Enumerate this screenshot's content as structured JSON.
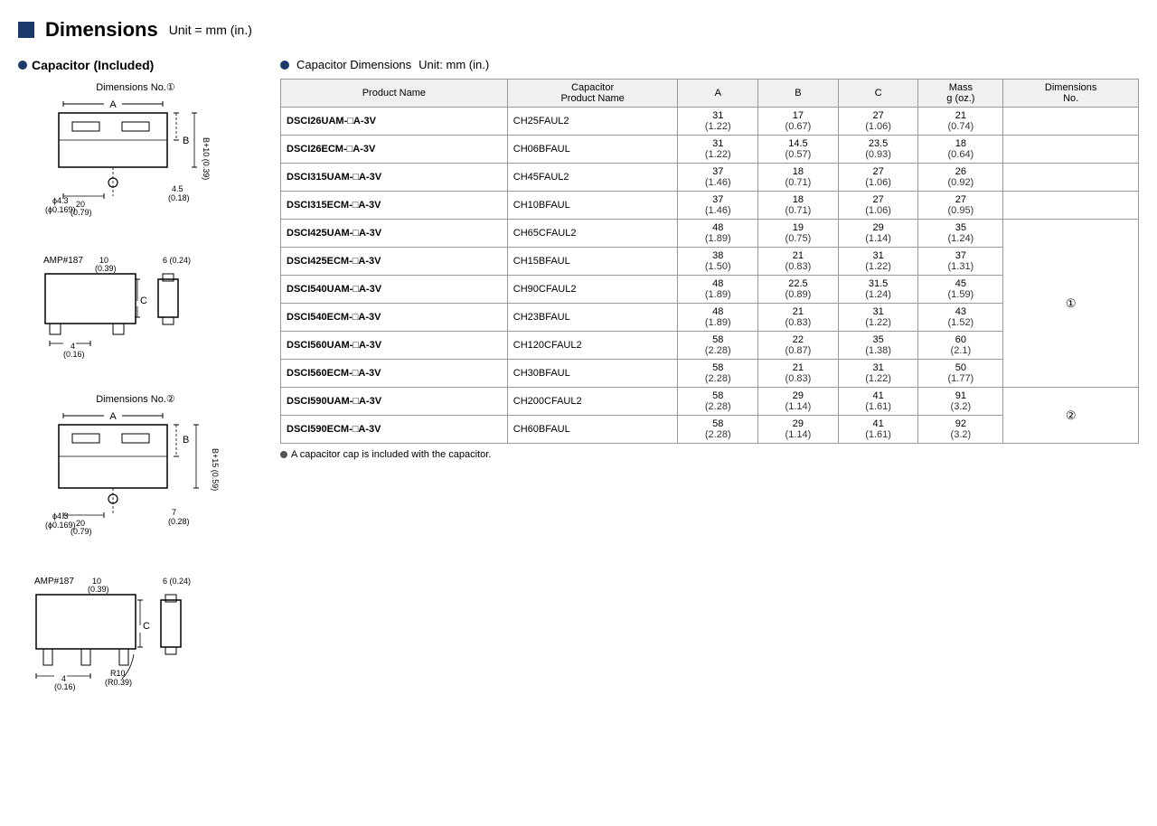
{
  "header": {
    "title": "Dimensions",
    "unit": "Unit = mm (in.)"
  },
  "left": {
    "section_label": "Capacitor (Included)",
    "diagrams": [
      {
        "label": "Dimensions No.①",
        "type": "dim1"
      },
      {
        "label": "",
        "type": "amp1"
      },
      {
        "label": "Dimensions No.②",
        "type": "dim2"
      },
      {
        "label": "",
        "type": "amp2"
      }
    ]
  },
  "right": {
    "table_heading": "Capacitor Dimensions",
    "table_unit": "Unit: mm (in.)",
    "columns": [
      "Product Name",
      "Capacitor Product Name",
      "A",
      "B",
      "C",
      "Mass g (oz.)",
      "Dimensions No."
    ],
    "rows": [
      {
        "product": "DSCI26UAM-□A-3V",
        "cap": "CH25FAUL2",
        "A": "31",
        "A_sub": "(1.22)",
        "B": "17",
        "B_sub": "(0.67)",
        "C": "27",
        "C_sub": "(1.06)",
        "mass": "21",
        "mass_sub": "(0.74)",
        "dim_no": ""
      },
      {
        "product": "DSCI26ECM-□A-3V",
        "cap": "CH06BFAUL",
        "A": "31",
        "A_sub": "(1.22)",
        "B": "14.5",
        "B_sub": "(0.57)",
        "C": "23.5",
        "C_sub": "(0.93)",
        "mass": "18",
        "mass_sub": "(0.64)",
        "dim_no": ""
      },
      {
        "product": "DSCI315UAM-□A-3V",
        "cap": "CH45FAUL2",
        "A": "37",
        "A_sub": "(1.46)",
        "B": "18",
        "B_sub": "(0.71)",
        "C": "27",
        "C_sub": "(1.06)",
        "mass": "26",
        "mass_sub": "(0.92)",
        "dim_no": ""
      },
      {
        "product": "DSCI315ECM-□A-3V",
        "cap": "CH10BFAUL",
        "A": "37",
        "A_sub": "(1.46)",
        "B": "18",
        "B_sub": "(0.71)",
        "C": "27",
        "C_sub": "(1.06)",
        "mass": "27",
        "mass_sub": "(0.95)",
        "dim_no": ""
      },
      {
        "product": "DSCI425UAM-□A-3V",
        "cap": "CH65CFAUL2",
        "A": "48",
        "A_sub": "(1.89)",
        "B": "19",
        "B_sub": "(0.75)",
        "C": "29",
        "C_sub": "(1.14)",
        "mass": "35",
        "mass_sub": "(1.24)",
        "dim_no": "①",
        "dim_rowspan": 8
      },
      {
        "product": "DSCI425ECM-□A-3V",
        "cap": "CH15BFAUL",
        "A": "38",
        "A_sub": "(1.50)",
        "B": "21",
        "B_sub": "(0.83)",
        "C": "31",
        "C_sub": "(1.22)",
        "mass": "37",
        "mass_sub": "(1.31)",
        "dim_no": ""
      },
      {
        "product": "DSCI540UAM-□A-3V",
        "cap": "CH90CFAUL2",
        "A": "48",
        "A_sub": "(1.89)",
        "B": "22.5",
        "B_sub": "(0.89)",
        "C": "31.5",
        "C_sub": "(1.24)",
        "mass": "45",
        "mass_sub": "(1.59)",
        "dim_no": ""
      },
      {
        "product": "DSCI540ECM-□A-3V",
        "cap": "CH23BFAUL",
        "A": "48",
        "A_sub": "(1.89)",
        "B": "21",
        "B_sub": "(0.83)",
        "C": "31",
        "C_sub": "(1.22)",
        "mass": "43",
        "mass_sub": "(1.52)",
        "dim_no": ""
      },
      {
        "product": "DSCI560UAM-□A-3V",
        "cap": "CH120CFAUL2",
        "A": "58",
        "A_sub": "(2.28)",
        "B": "22",
        "B_sub": "(0.87)",
        "C": "35",
        "C_sub": "(1.38)",
        "mass": "60",
        "mass_sub": "(2.1)",
        "dim_no": ""
      },
      {
        "product": "DSCI560ECM-□A-3V",
        "cap": "CH30BFAUL",
        "A": "58",
        "A_sub": "(2.28)",
        "B": "21",
        "B_sub": "(0.83)",
        "C": "31",
        "C_sub": "(1.22)",
        "mass": "50",
        "mass_sub": "(1.77)",
        "dim_no": ""
      },
      {
        "product": "DSCI590UAM-□A-3V",
        "cap": "CH200CFAUL2",
        "A": "58",
        "A_sub": "(2.28)",
        "B": "29",
        "B_sub": "(1.14)",
        "C": "41",
        "C_sub": "(1.61)",
        "mass": "91",
        "mass_sub": "(3.2)",
        "dim_no": "②",
        "dim_rowspan": 2
      },
      {
        "product": "DSCI590ECM-□A-3V",
        "cap": "CH60BFAUL",
        "A": "58",
        "A_sub": "(2.28)",
        "B": "29",
        "B_sub": "(1.14)",
        "C": "41",
        "C_sub": "(1.61)",
        "mass": "92",
        "mass_sub": "(3.2)",
        "dim_no": ""
      }
    ],
    "footnote": "A capacitor cap is included with the capacitor."
  }
}
